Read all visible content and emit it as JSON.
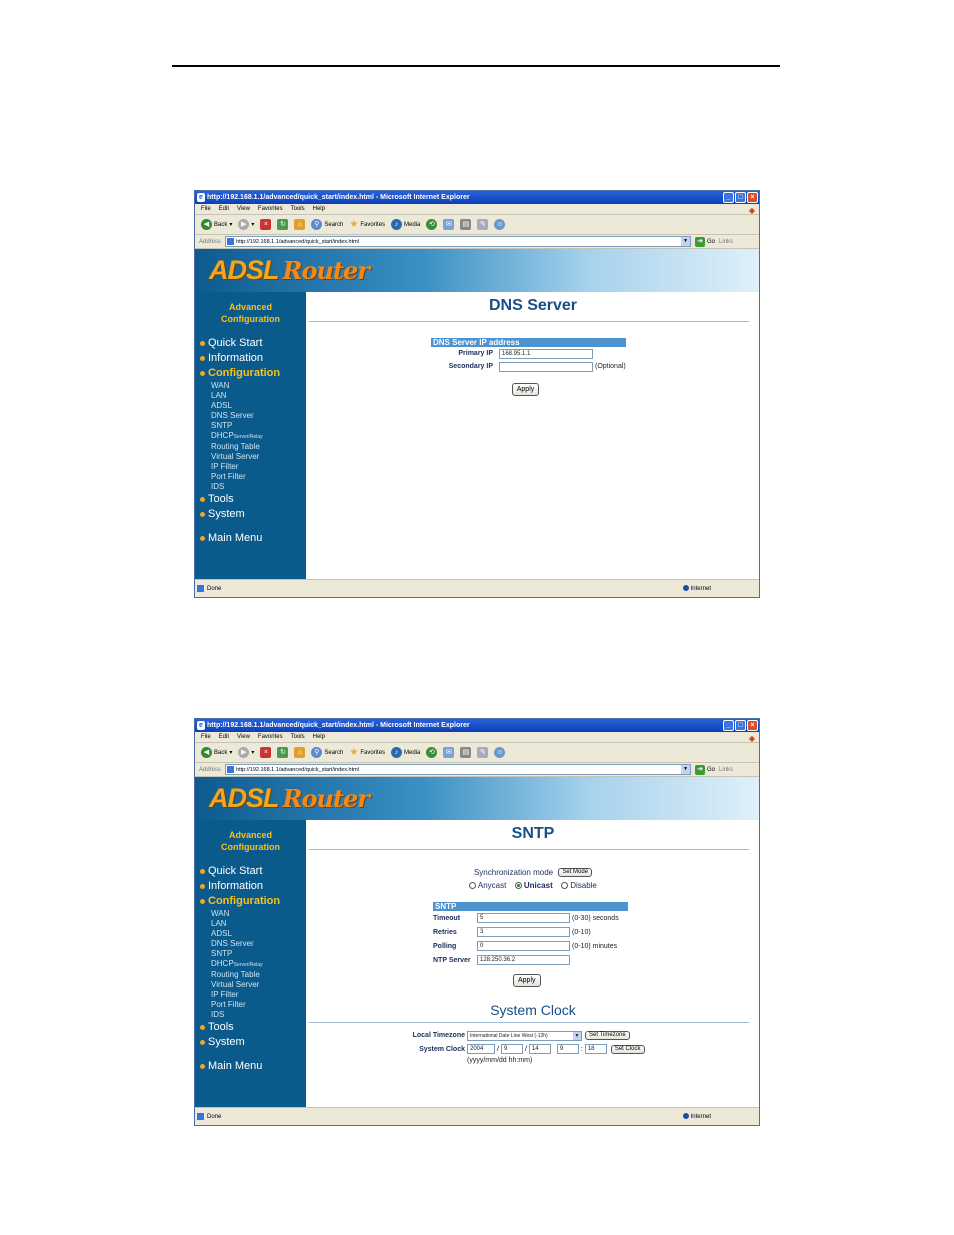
{
  "shared": {
    "window_title": "http://192.168.1.1/advanced/quick_start/index.html - Microsoft Internet Explorer",
    "menu": [
      "File",
      "Edit",
      "View",
      "Favorites",
      "Tools",
      "Help"
    ],
    "toolbar": {
      "back": "Back",
      "search": "Search",
      "favorites": "Favorites",
      "media": "Media"
    },
    "address_label": "Address",
    "address": "http://192.168.1.1/advanced/quick_start/index.html",
    "go": "Go",
    "links": "Links",
    "status": "Done",
    "zone": "Internet",
    "brand": {
      "part1": "ADSL",
      "part2": "Router"
    },
    "side_heading": "Advanced\nConfiguration",
    "nav": {
      "quick_start": "Quick Start",
      "information": "Information",
      "configuration": "Configuration",
      "sub": [
        "WAN",
        "LAN",
        "ADSL",
        "DNS Server",
        "SNTP"
      ],
      "dhcp": "DHCP",
      "dhcp_small": "Server/Relay",
      "sub2": [
        "Routing Table",
        "Virtual Server",
        "IP Filter",
        "Port Filter",
        "IDS"
      ],
      "tools": "Tools",
      "system": "System",
      "main_menu": "Main Menu"
    }
  },
  "dns": {
    "title": "DNS Server",
    "box_title": "DNS Server IP address",
    "primary_label": "Primary IP",
    "primary_value": "168.95.1.1",
    "secondary_label": "Secondary IP",
    "secondary_value": "",
    "optional": "(Optional)",
    "apply": "Apply"
  },
  "sntp": {
    "title": "SNTP",
    "sync_label": "Synchronization mode",
    "set_mode": "Set Mode",
    "modes": {
      "anycast": "Anycast",
      "unicast": "Unicast",
      "disable": "Disable"
    },
    "selected_mode": "Unicast",
    "box_title": "SNTP",
    "timeout_label": "Timeout",
    "timeout_value": "5",
    "timeout_note": "(0-30) seconds",
    "retries_label": "Retries",
    "retries_value": "3",
    "retries_note": "(0-10)",
    "polling_label": "Polling",
    "polling_value": "0",
    "polling_note": "(0-10) minutes",
    "ntp_label": "NTP Server",
    "ntp_value": "128.250.36.2",
    "apply": "Apply",
    "clock_title": "System Clock",
    "tz_label": "Local Timezone",
    "tz_value": "International Date Line West (-12h)",
    "set_timezone": "Set Timezone",
    "clock_label": "System Clock",
    "year": "2004",
    "month": "9",
    "day": "14",
    "hour": "9",
    "minute": "18",
    "sep_slash": "/",
    "sep_colon": ":",
    "set_clock": "Set Clock",
    "format_hint": "(yyyy/mm/dd hh:mm)"
  }
}
